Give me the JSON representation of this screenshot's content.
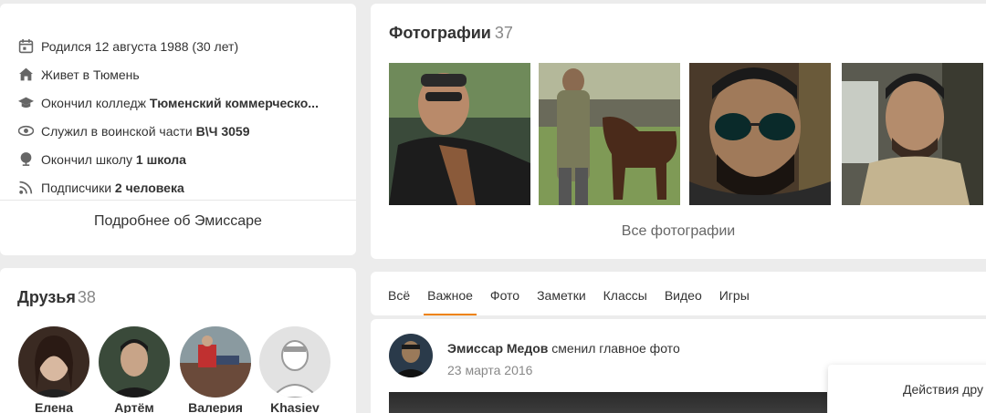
{
  "about": {
    "items": [
      {
        "icon": "calendar-icon",
        "text": "Родился 12 августа 1988 (30 лет)",
        "bold": ""
      },
      {
        "icon": "home-icon",
        "text": "Живет в Тюмень",
        "bold": ""
      },
      {
        "icon": "graduation-cap-icon",
        "text": "Окончил колледж ",
        "bold": "Тюменский коммерческо..."
      },
      {
        "icon": "military-icon",
        "text": "Служил в воинской части ",
        "bold": "В\\Ч 3059"
      },
      {
        "icon": "school-icon",
        "text": "Окончил школу ",
        "bold": "1 школа"
      },
      {
        "icon": "rss-icon",
        "text": "Подписчики ",
        "bold": "2 человека"
      }
    ],
    "more_label": "Подробнее об Эмиссаре"
  },
  "photos": {
    "title": "Фотографии",
    "count": "37",
    "all_label": "Все фотографии"
  },
  "friends": {
    "title": "Друзья",
    "count": "38",
    "items": [
      {
        "name": "Елена"
      },
      {
        "name": "Артём"
      },
      {
        "name": "Валерия"
      },
      {
        "name": "Khasiev"
      }
    ]
  },
  "feed": {
    "tabs": [
      "Всё",
      "Важное",
      "Фото",
      "Заметки",
      "Классы",
      "Видео",
      "Игры"
    ],
    "active_tab": "Важное"
  },
  "post": {
    "author": "Эмиссар Медов",
    "action": " сменил главное фото",
    "date": "23 марта 2016"
  },
  "actions_popup": {
    "label": "Действия дру"
  },
  "colors": {
    "accent": "#ee8208",
    "background": "#ececec"
  }
}
